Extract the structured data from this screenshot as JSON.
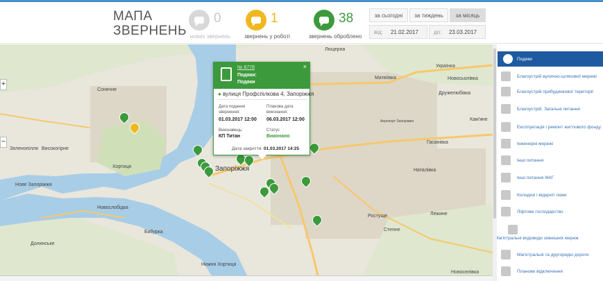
{
  "header": {
    "title_line1": "МАПА",
    "title_line2": "ЗВЕРНЕНЬ",
    "stats": [
      {
        "count": "0",
        "label": "нових звернень",
        "color": "#d8d8d8"
      },
      {
        "count": "1",
        "label": "звернень у роботі",
        "color": "#f0b820"
      },
      {
        "count": "38",
        "label": "звернень оброблено",
        "color": "#3c9a3c"
      }
    ],
    "periods": [
      "за сьогодні",
      "за тиждень",
      "за місяць"
    ],
    "active_period": "за місяць",
    "date_from_label": "від:",
    "date_from": "21.02.2017",
    "date_to_label": "до:",
    "date_to": "23.03.2017"
  },
  "map": {
    "zoom_in": "+",
    "zoom_out": "−",
    "labels": {
      "lyutserna": "Люцерна",
      "matviivka": "Матвіївка",
      "ukrainka": "Українка",
      "novoselivka": "Новосьолівка",
      "druzhelyubivka": "Дружелюбівка",
      "kamiane": "Кам'яне",
      "soniachne": "Сонячне",
      "zelenopillia": "Зеленопілля",
      "vysokogirne": "Високогірне",
      "khortytsia": "Хортиця",
      "zaporizhzhia": "Запоріжжя",
      "nove_zaporizhzhia": "Нове Запоріжжя",
      "hasanivka": "Гасанівка",
      "natalivka": "Наталівка",
      "novoslobidka": "Новослобідка",
      "baburka": "Бабурка",
      "dolynske": "Долинське",
      "nyzhnia_khortytsia": "Нижня Хортиця",
      "lezhyne": "Лежине",
      "stepne": "Степне",
      "rostushche": "Ростуще",
      "novosilivka": "Новоселівка",
      "airport": "Аеропорт Запоріжжя"
    }
  },
  "popup": {
    "number": "№ 6778",
    "category_line1": "Подяки:",
    "category_line2": "Подяки",
    "address": "вулиця Профспілкова 4, Запоріжжя",
    "filed_label": "Дата подання звернення:",
    "filed_value": "01.03.2017 12:00",
    "planned_label": "Планова дата виконання:",
    "planned_value": "06.03.2017 12:00",
    "executor_label": "Виконавець:",
    "executor_value": "КП Титан",
    "status_label": "Статус",
    "status_value": "Виконано",
    "closed_label": "Дата закриття:",
    "closed_value": "01.03.2017 14:25",
    "close_symbol": "×"
  },
  "sidebar": {
    "items": [
      {
        "label": "Подяки",
        "icon": "thanks-icon"
      },
      {
        "label": "Благоустрій вулично-шляхової мережі",
        "icon": "road-icon"
      },
      {
        "label": "Благоустрій прибудинкової території",
        "icon": "yard-icon"
      },
      {
        "label": "Благоустрій. Загальні питання",
        "icon": "yard-general-icon"
      },
      {
        "label": "Експлуатація і ремонт житлового фонду",
        "icon": "housing-icon"
      },
      {
        "label": "Інженерні мережі",
        "icon": "engineering-icon"
      },
      {
        "label": "Інші питання",
        "icon": "other-icon"
      },
      {
        "label": "Інші питання ЖКГ",
        "icon": "utility-icon"
      },
      {
        "label": "Колодязі і відкриті люки",
        "icon": "well-icon"
      },
      {
        "label": "Ліфтове господарство",
        "icon": "elevator-icon"
      },
      {
        "label": "Магістральні водоводи зовнішніх мереж",
        "icon": "water-main-icon"
      },
      {
        "label": "Магістральні та другорядні дороги",
        "icon": "main-road-icon"
      },
      {
        "label": "Планове відключення",
        "icon": "outage-icon"
      }
    ]
  }
}
